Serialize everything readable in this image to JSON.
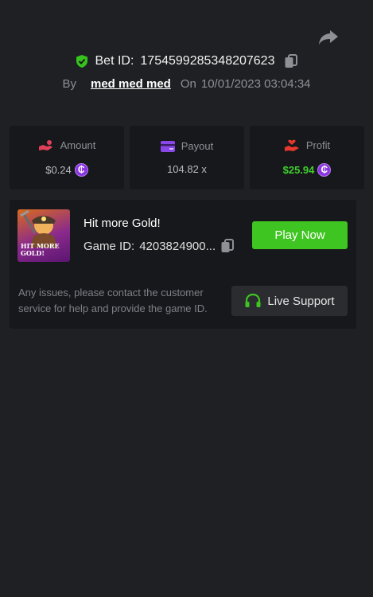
{
  "bet": {
    "label": "Bet ID:",
    "id": "1754599285348207623"
  },
  "by": {
    "by_label": "By",
    "username": "med med med",
    "on_label": "On",
    "timestamp": "10/01/2023 03:04:34"
  },
  "stats": {
    "amount": {
      "label": "Amount",
      "value": "$0.24"
    },
    "payout": {
      "label": "Payout",
      "value": "104.82 x"
    },
    "profit": {
      "label": "Profit",
      "value": "$25.94"
    }
  },
  "game": {
    "title": "Hit more Gold!",
    "id_label": "Game ID:",
    "id_value": "4203824900...",
    "thumb_text_line1": "HIT MORE",
    "thumb_text_line2": "GOLD!",
    "play_label": "Play Now"
  },
  "support": {
    "help_text": "Any issues, please contact the customer service for help and provide the game ID.",
    "button_label": "Live Support"
  },
  "colors": {
    "background": "#1f2024",
    "card": "#17181b",
    "accent_green": "#3fc521",
    "profit_green": "#3fcf2e",
    "coin_purple": "#8a35e0"
  },
  "icons": {
    "share": "share-arrow-icon",
    "verified": "shield-check-icon",
    "copy": "copy-icon",
    "amount": "hand-coin-icon",
    "payout": "card-icon",
    "profit": "hand-heart-icon",
    "currency": "coin-icon",
    "support": "headset-icon"
  }
}
